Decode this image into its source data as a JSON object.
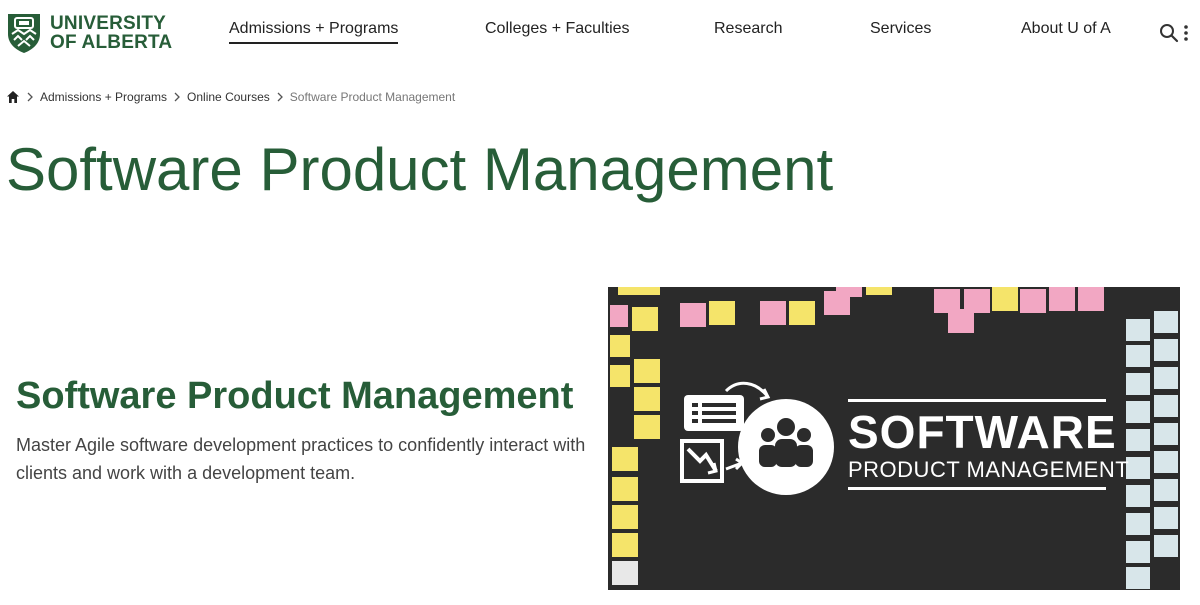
{
  "header": {
    "logo_line1": "UNIVERSITY",
    "logo_line2": "OF ALBERTA",
    "nav": [
      {
        "label": "Admissions + Programs"
      },
      {
        "label": "Colleges + Faculties"
      },
      {
        "label": "Research"
      },
      {
        "label": "Services"
      },
      {
        "label": "About U of A"
      }
    ]
  },
  "breadcrumb": {
    "items": [
      {
        "label": "Admissions + Programs"
      },
      {
        "label": "Online Courses"
      }
    ],
    "current": "Software Product Management"
  },
  "page_title": "Software Product Management",
  "hero": {
    "heading": "Software Product Management",
    "description": "Master Agile software development practices to confidently interact with clients and work with a development team.",
    "image_title": "SOFTWARE",
    "image_subtitle": "PRODUCT MANAGEMENT"
  },
  "colors": {
    "brand_green": "#275d38",
    "image_bg": "#2b2b2b"
  }
}
